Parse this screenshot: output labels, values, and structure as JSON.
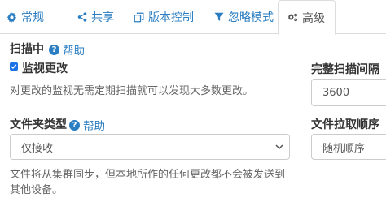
{
  "tabs": [
    {
      "label": "常规",
      "icon": "gear-icon"
    },
    {
      "label": "共享",
      "icon": "share-icon"
    },
    {
      "label": "版本控制",
      "icon": "copy-icon"
    },
    {
      "label": "忽略模式",
      "icon": "filter-icon"
    },
    {
      "label": "高级",
      "icon": "cogs-icon"
    }
  ],
  "scanning": {
    "label": "扫描中",
    "help": "帮助",
    "watch_checkbox_label": "监视更改",
    "watch_checked": true,
    "description": "对更改的监视无需定期扫描就可以发现大多数更改。"
  },
  "full_rescan": {
    "label": "完整扫描间隔（",
    "value": "3600"
  },
  "folder_type": {
    "label": "文件夹类型",
    "help": "帮助",
    "selected": "仅接收",
    "description_line1": "文件将从集群同步，但本地所作的任何更改都不会被发送到",
    "description_line2": "其他设备。"
  },
  "pull_order": {
    "label": "文件拉取顺序",
    "selected": "随机顺序"
  },
  "colors": {
    "link": "#2a7ec1",
    "checkbox": "#1e72e8"
  }
}
